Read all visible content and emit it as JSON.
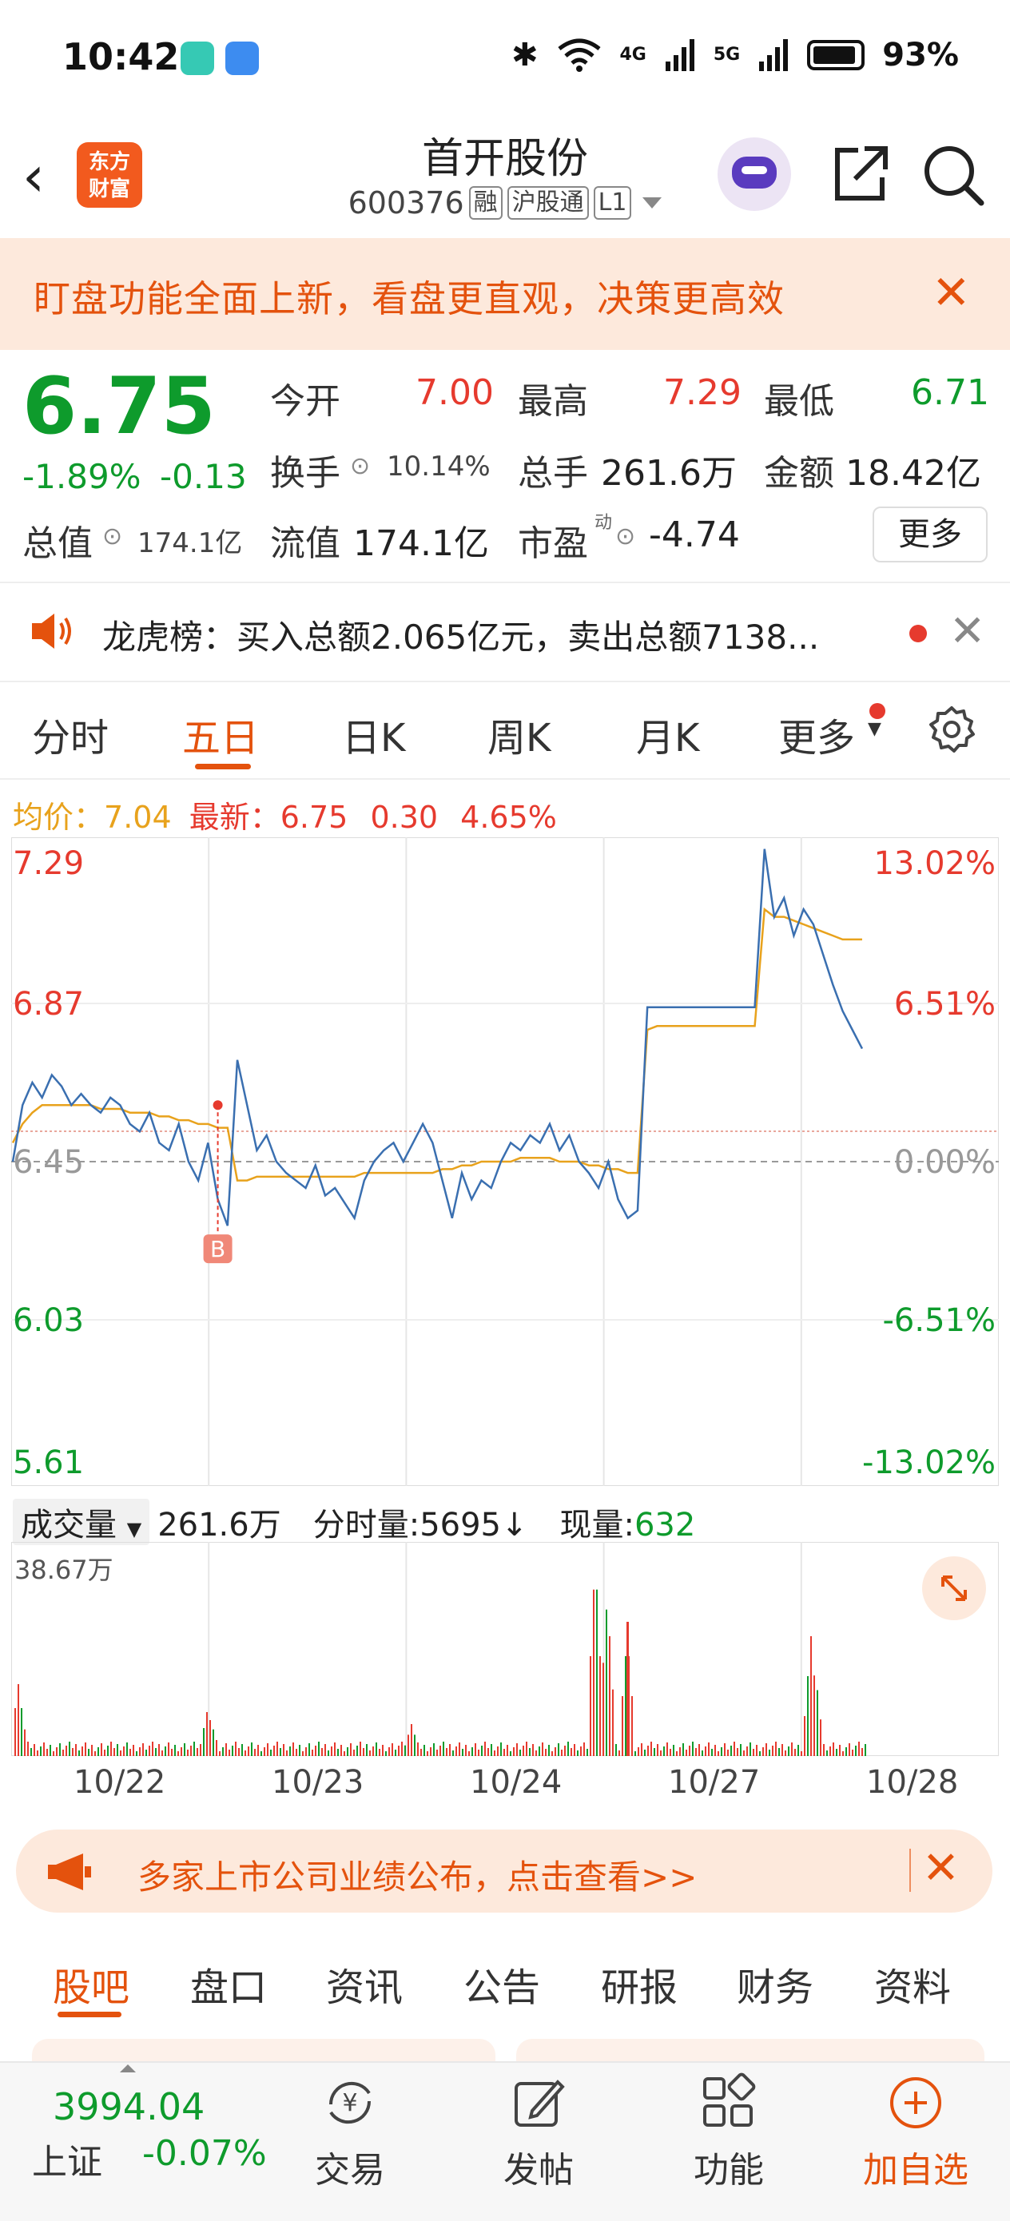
{
  "status_bar": {
    "time": "10:42",
    "network1": "4G",
    "network2": "5G",
    "battery": "93%"
  },
  "header": {
    "app_logo": "东方财富",
    "title": "首开股份",
    "code": "600376",
    "tags": [
      "融",
      "沪股通",
      "L1"
    ]
  },
  "banner": {
    "text": "盯盘功能全面上新，看盘更直观，决策更高效",
    "close": "✕"
  },
  "quote": {
    "price": "6.75",
    "change_pct": "-1.89%",
    "change": "-0.13",
    "open_label": "今开",
    "open": "7.00",
    "high_label": "最高",
    "high": "7.29",
    "low_label": "最低",
    "low": "6.71",
    "turnover_label": "换手",
    "turnover": "10.14%",
    "volume_label": "总手",
    "volume": "261.6万",
    "amount_label": "金额",
    "amount": "18.42亿",
    "mktcap_label": "总值",
    "mktcap": "174.1亿",
    "float_label": "流值",
    "float": "174.1亿",
    "pe_label": "市盈",
    "pe_super": "动",
    "pe": "-4.74",
    "more": "更多"
  },
  "dragon_tiger": {
    "text": "龙虎榜：买入总额2.065亿元，卖出总额7138...",
    "close": "✕"
  },
  "chart_tabs": [
    "分时",
    "五日",
    "日K",
    "周K",
    "月K",
    "更多"
  ],
  "active_tab": "五日",
  "avg_line": {
    "avg_label": "均价：",
    "avg": "7.04",
    "last_label": "最新：",
    "last": "6.75",
    "chg": "0.30",
    "chg_pct": "4.65%"
  },
  "vol_header": {
    "selector": "成交量",
    "total": "261.6万",
    "tick_label": "分时量:",
    "tick_value": "5695",
    "tick_arrow": "↓",
    "now_label": "现量:",
    "now_value": "632"
  },
  "chart_data": {
    "type": "line",
    "title": "",
    "x_dates": [
      "10/22",
      "10/23",
      "10/24",
      "10/27",
      "10/28"
    ],
    "y_ticks_price": [
      "7.29",
      "6.87",
      "6.45",
      "6.03",
      "5.61"
    ],
    "y_ticks_pct": [
      "13.02%",
      "6.51%",
      "0.00%",
      "-6.51%",
      "-13.02%"
    ],
    "ylim": [
      5.61,
      7.29
    ],
    "prev_close": 6.45,
    "buy_marker": "B",
    "series": [
      {
        "values": [
          6.45,
          6.6,
          6.66,
          6.62,
          6.68,
          6.65,
          6.6,
          6.63,
          6.6,
          6.58,
          6.62,
          6.6,
          6.55,
          6.53,
          6.58,
          6.5,
          6.48,
          6.55,
          6.45,
          6.4,
          6.5,
          6.35,
          6.28,
          6.72,
          6.6,
          6.48,
          6.52,
          6.45,
          6.42,
          6.4,
          6.38,
          6.44,
          6.36,
          6.38,
          6.34,
          6.3,
          6.4,
          6.45,
          6.48,
          6.5,
          6.45,
          6.5,
          6.55,
          6.5,
          6.4,
          6.3,
          6.42,
          6.35,
          6.4,
          6.38,
          6.45,
          6.5,
          6.48,
          6.52,
          6.5,
          6.55,
          6.48,
          6.52,
          6.45,
          6.42,
          6.38,
          6.45,
          6.35,
          6.3,
          6.32,
          6.86,
          6.86,
          6.86,
          6.86,
          6.86,
          6.86,
          6.86,
          6.86,
          6.86,
          6.86,
          6.86,
          6.86,
          7.28,
          7.1,
          7.15,
          7.05,
          7.12,
          7.08,
          7.0,
          6.92,
          6.85,
          6.8,
          6.75
        ],
        "avg_values": [
          6.5,
          6.55,
          6.58,
          6.6,
          6.6,
          6.6,
          6.6,
          6.6,
          6.6,
          6.59,
          6.59,
          6.59,
          6.58,
          6.58,
          6.58,
          6.57,
          6.57,
          6.56,
          6.56,
          6.55,
          6.55,
          6.54,
          6.54,
          6.4,
          6.4,
          6.41,
          6.41,
          6.41,
          6.41,
          6.41,
          6.41,
          6.41,
          6.41,
          6.41,
          6.41,
          6.41,
          6.42,
          6.42,
          6.42,
          6.42,
          6.42,
          6.42,
          6.42,
          6.42,
          6.43,
          6.43,
          6.44,
          6.44,
          6.45,
          6.45,
          6.45,
          6.45,
          6.46,
          6.46,
          6.46,
          6.46,
          6.45,
          6.45,
          6.45,
          6.44,
          6.44,
          6.43,
          6.43,
          6.42,
          6.42,
          6.8,
          6.81,
          6.81,
          6.81,
          6.81,
          6.81,
          6.81,
          6.81,
          6.81,
          6.81,
          6.81,
          6.81,
          7.12,
          7.1,
          7.1,
          7.09,
          7.08,
          7.07,
          7.06,
          7.05,
          7.04,
          7.04,
          7.04
        ]
      }
    ]
  },
  "volume_data": {
    "max_label": "38.67万"
  },
  "promo": {
    "text": "多家上市公司业绩公布，点击查看>>",
    "close": "✕"
  },
  "sub_tabs": [
    "股吧",
    "盘口",
    "资讯",
    "公告",
    "研报",
    "财务",
    "资料"
  ],
  "active_sub_tab": "股吧",
  "bottom_nav": {
    "index_value": "3994.04",
    "index_name": "上证",
    "index_change": "-0.07%",
    "items": [
      "交易",
      "发帖",
      "功能",
      "加自选"
    ]
  },
  "colors": {
    "accent": "#e4520d",
    "up": "#e63a2e",
    "down": "#0e9b2c",
    "price_line": "#3a6fb0",
    "avg_line": "#e8a21c"
  },
  "icons": [
    "back-icon",
    "share-icon",
    "search-icon",
    "speaker-icon",
    "gear-icon",
    "expand-icon",
    "megaphone-icon",
    "trade-icon",
    "post-icon",
    "function-icon",
    "add-watch-icon"
  ]
}
